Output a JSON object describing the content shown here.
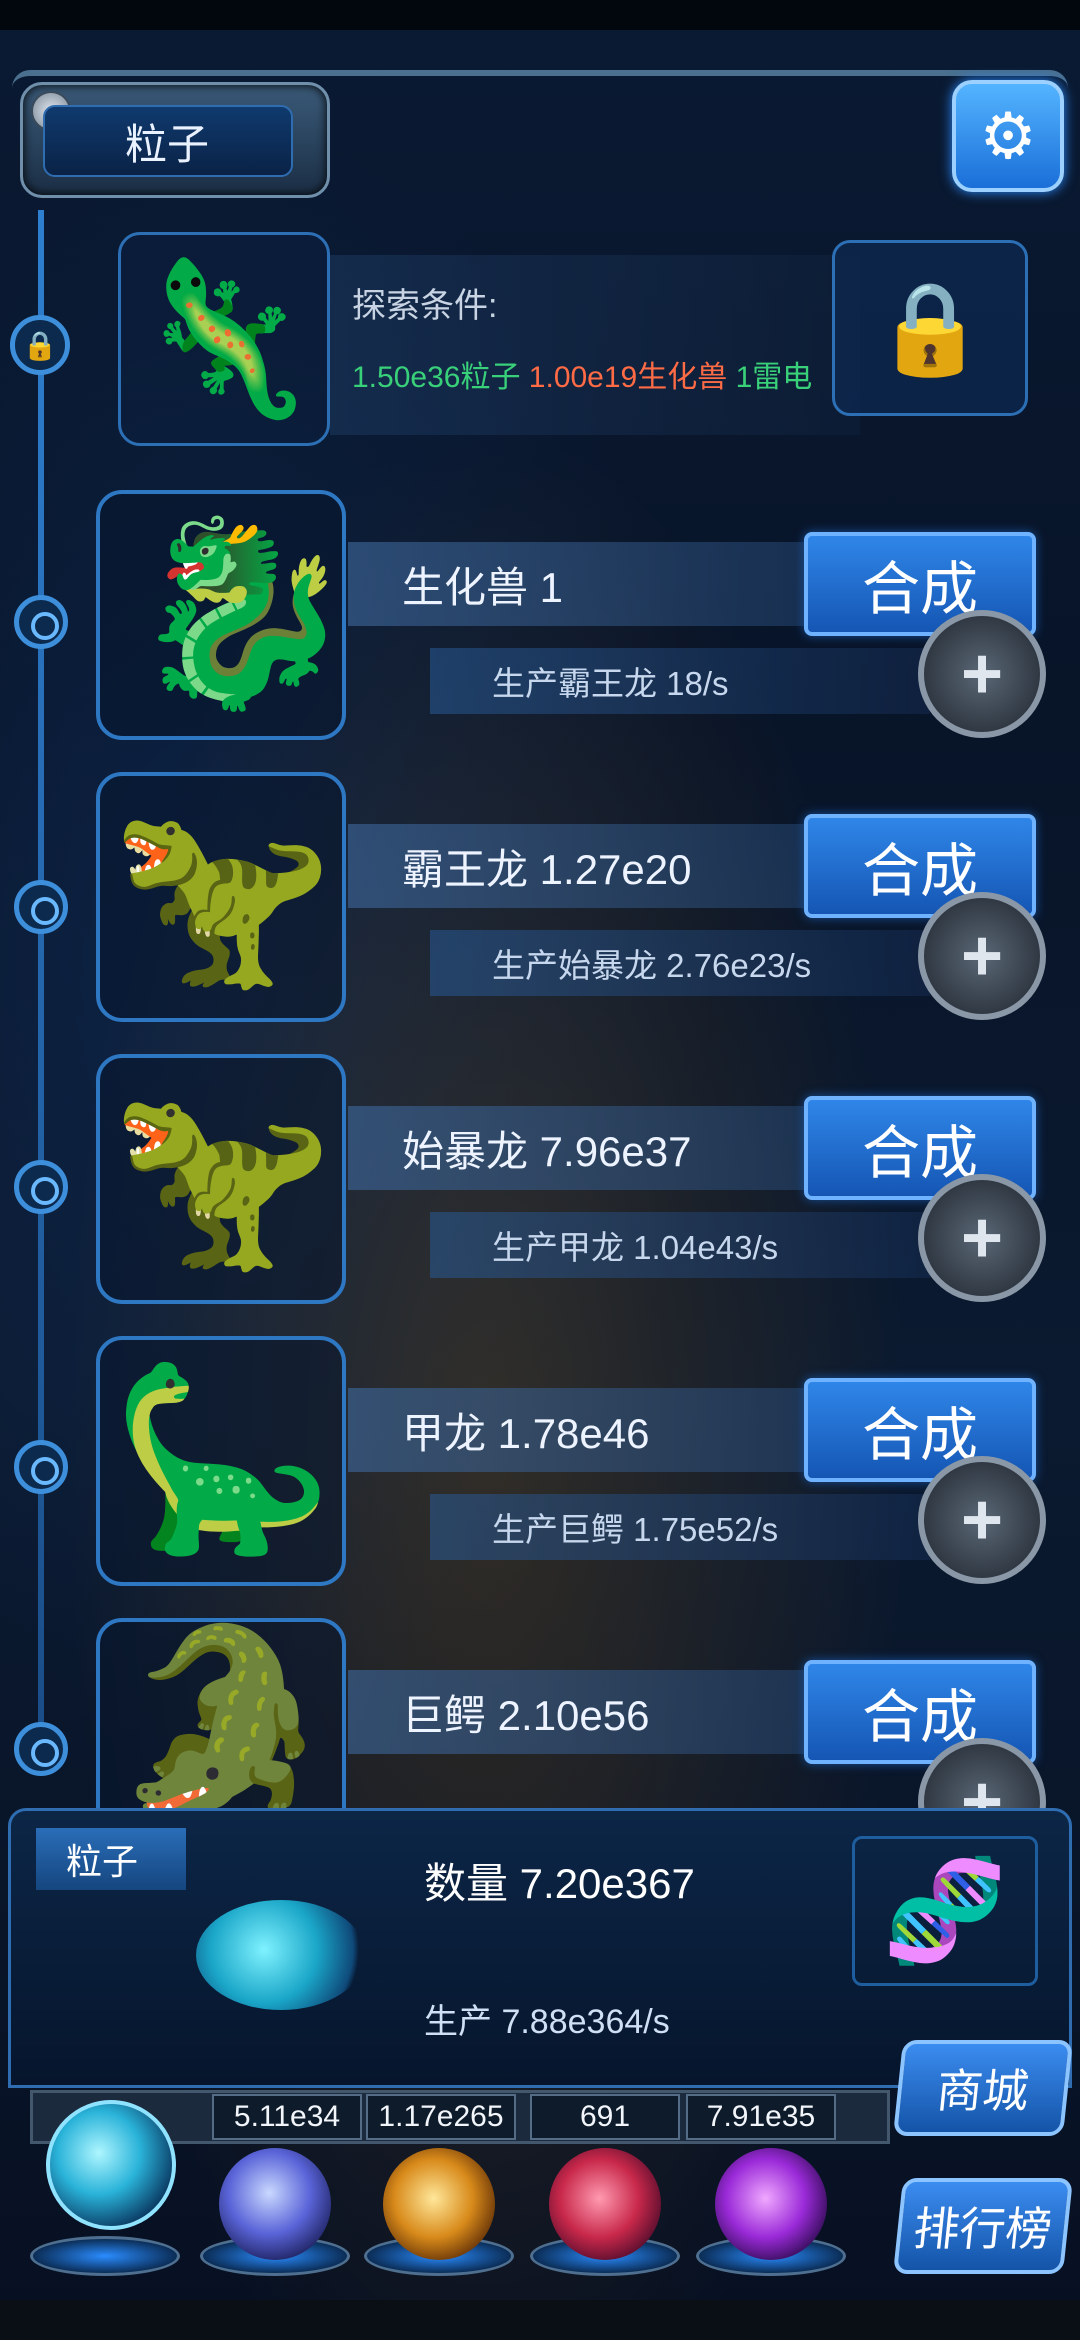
{
  "header": {
    "title": "粒子",
    "settings_icon": "gear-icon"
  },
  "locked": {
    "cond_title": "探索条件:",
    "cond_particles": "1.50e36粒子",
    "cond_biochem": "1.00e19生化兽",
    "cond_thunder": "1雷电"
  },
  "rows": [
    {
      "name": "生化兽 1",
      "prod": "生产霸王龙 18/s",
      "synth": "合成",
      "art": "🐉"
    },
    {
      "name": "霸王龙 1.27e20",
      "prod": "生产始暴龙 2.76e23/s",
      "synth": "合成",
      "art": "🦖"
    },
    {
      "name": "始暴龙 7.96e37",
      "prod": "生产甲龙 1.04e43/s",
      "synth": "合成",
      "art": "🦖"
    },
    {
      "name": "甲龙 1.78e46",
      "prod": "生产巨鳄 1.75e52/s",
      "synth": "合成",
      "art": "🦕"
    },
    {
      "name": "巨鳄 2.10e56",
      "prod": "",
      "synth": "合成",
      "art": "🐊"
    }
  ],
  "panel": {
    "label": "粒子",
    "qty": "数量 7.20e367",
    "prod": "生产 7.88e364/s"
  },
  "resources": [
    "5.11e34",
    "1.17e265",
    "691",
    "7.91e35"
  ],
  "side_buttons": {
    "shop": "商城",
    "rank": "排行榜"
  },
  "colors": {
    "accent": "#2f86e8",
    "green": "#39d07a",
    "red": "#ff6b45"
  }
}
